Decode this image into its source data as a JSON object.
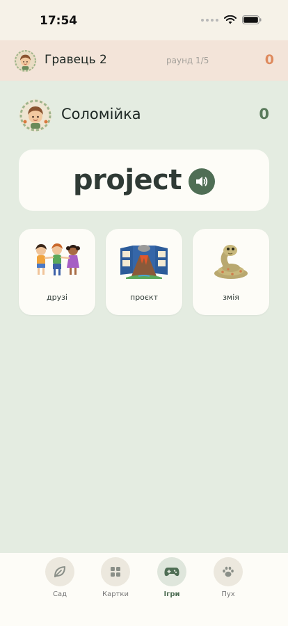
{
  "status": {
    "time": "17:54"
  },
  "opponent": {
    "name": "Гравець 2",
    "round": "раунд 1/5",
    "score": "0"
  },
  "player": {
    "name": "Соломійка",
    "score": "0"
  },
  "word": {
    "text": "project"
  },
  "options": [
    {
      "label": "друзі",
      "icon": "friends-illustration"
    },
    {
      "label": "проєкт",
      "icon": "volcano-project-illustration"
    },
    {
      "label": "змія",
      "icon": "snake-illustration"
    }
  ],
  "tabs": [
    {
      "label": "Сад",
      "icon": "leaf-icon"
    },
    {
      "label": "Картки",
      "icon": "grid-icon"
    },
    {
      "label": "Ігри",
      "icon": "gamepad-icon",
      "active": true
    },
    {
      "label": "Пух",
      "icon": "paw-icon"
    }
  ],
  "colors": {
    "accent": "#4f6e55",
    "opponent_score": "#de8a5e",
    "background": "#e4ece1"
  }
}
